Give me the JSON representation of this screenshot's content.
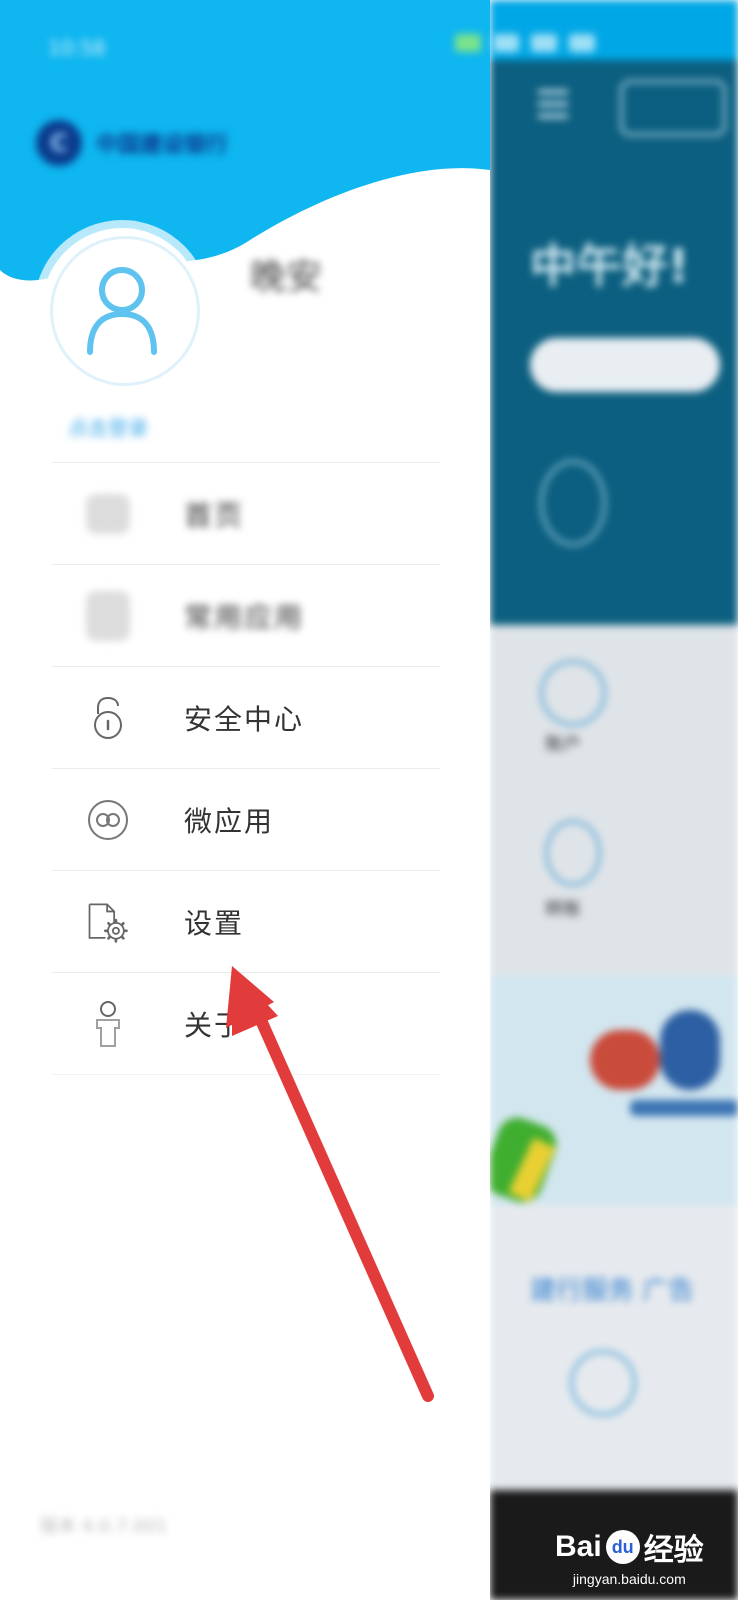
{
  "status_bar": {
    "time": "10:58"
  },
  "drawer": {
    "logo_text": "中国建设银行",
    "user_name": "晚安",
    "login_link": "点击登录",
    "menu": [
      {
        "label": "首页",
        "icon": "blurred-icon",
        "blurred": true
      },
      {
        "label": "常用应用",
        "icon": "blurred-icon",
        "blurred": true
      },
      {
        "label": "安全中心",
        "icon": "lock-icon",
        "blurred": false
      },
      {
        "label": "微应用",
        "icon": "link-icon",
        "blurred": false
      },
      {
        "label": "设置",
        "icon": "settings-icon",
        "blurred": false
      },
      {
        "label": "关于",
        "icon": "person-icon",
        "blurred": false
      }
    ],
    "version_text": "版本 4.0.7.001"
  },
  "main_screen": {
    "greeting": "中午好!",
    "label_a": "账户",
    "label_b": "转账",
    "promo_text": "建行服务 广告"
  },
  "watermark": {
    "brand_left": "Bai",
    "brand_right": "经验",
    "sub": "jingyan.baidu.com"
  },
  "colors": {
    "brand_blue": "#00b3f0",
    "header_dark": "#0c5f80",
    "annotation_red": "#e23b3b"
  }
}
